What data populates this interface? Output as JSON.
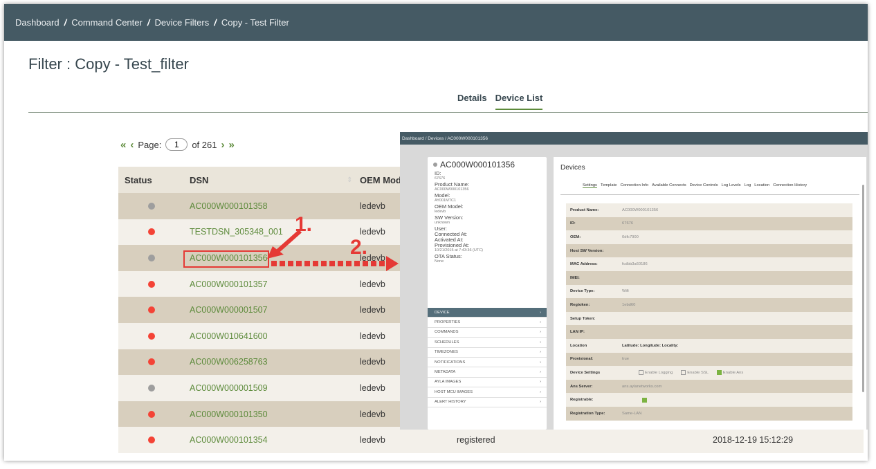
{
  "breadcrumb": [
    "Dashboard",
    "Command Center",
    "Device Filters",
    "Copy - Test Filter"
  ],
  "page_title": "Filter : Copy - Test_filter",
  "tabs": {
    "details": "Details",
    "device_list": "Device List"
  },
  "pager": {
    "label": "Page:",
    "value": "1",
    "of": "of 261"
  },
  "table": {
    "headers": {
      "status": "Status",
      "dsn": "DSN",
      "oem_model": "OEM Mode"
    },
    "rows": [
      {
        "status": "grey",
        "dsn": "AC000W000101358",
        "oem": "ledevb"
      },
      {
        "status": "red",
        "dsn": "TESTDSN_305348_001",
        "oem": "ledevb"
      },
      {
        "status": "grey",
        "dsn": "AC000W000101356",
        "oem": "ledevb"
      },
      {
        "status": "red",
        "dsn": "AC000W000101357",
        "oem": "ledevb"
      },
      {
        "status": "red",
        "dsn": "AC000W000001507",
        "oem": "ledevb"
      },
      {
        "status": "red",
        "dsn": "AC000W010641600",
        "oem": "ledevb"
      },
      {
        "status": "red",
        "dsn": "AC000W006258763",
        "oem": "ledevb"
      },
      {
        "status": "grey",
        "dsn": "AC000W000001509",
        "oem": "ledevb"
      },
      {
        "status": "red",
        "dsn": "AC000W000101350",
        "oem": "ledevb"
      },
      {
        "status": "red",
        "dsn": "AC000W000101354",
        "oem": "ledevb",
        "connection": "registered",
        "timestamp": "2018-12-19 15:12:29"
      }
    ]
  },
  "annotations": {
    "step1": "1.",
    "step2": "2."
  },
  "colors": {
    "red": "#f44336",
    "grey": "#9e9e9e",
    "green": "#5c8a3a",
    "header": "#455a64"
  },
  "inset": {
    "breadcrumb": "Dashboard  /  Devices  /  AC000W000101356",
    "device_title": "AC000W000101356",
    "fields": [
      {
        "label": "ID:",
        "value": "67676"
      },
      {
        "label": "Product Name:",
        "value": "AC000W000101356"
      },
      {
        "label": "Model:",
        "value": "AY001MTC1"
      },
      {
        "label": "OEM Model:",
        "value": "ledevb"
      },
      {
        "label": "SW Version:",
        "value": "unknown"
      },
      {
        "label": "User:",
        "value": ""
      },
      {
        "label": "Connected At:",
        "value": ""
      },
      {
        "label": "Activated At:",
        "value": ""
      },
      {
        "label": "Provisioned At:",
        "value": "10/21/2015 at 7:43:36 (UTC)"
      },
      {
        "label": "OTA Status:",
        "value": "None"
      }
    ],
    "menu": [
      "DEVICE",
      "PROPERTIES",
      "COMMANDS",
      "SCHEDULES",
      "TIMEZONES",
      "NOTIFICATIONS",
      "METADATA",
      "AYLA IMAGES",
      "HOST MCU IMAGES",
      "ALERT HISTORY"
    ],
    "panel_title": "Devices",
    "panel_tabs": [
      "Settings",
      "Template",
      "Connection Info",
      "Available Connects",
      "Device Controls",
      "Log Levels",
      "Log",
      "Location",
      "Connection History"
    ],
    "settings": [
      {
        "label": "Product Name:",
        "value": "AC000W000101356"
      },
      {
        "label": "ID:",
        "value": "67676"
      },
      {
        "label": "OEM:",
        "value": "0dfc7900"
      },
      {
        "label": "Host SW Version:",
        "value": ""
      },
      {
        "label": "MAC Address:",
        "value": "fcdbb3a60186"
      },
      {
        "label": "IMEI:",
        "value": ""
      },
      {
        "label": "Device Type:",
        "value": "Wifi"
      },
      {
        "label": "Regtoken:",
        "value": "1ebd60"
      },
      {
        "label": "Setup Token:",
        "value": ""
      },
      {
        "label": "LAN IP:",
        "value": ""
      },
      {
        "label": "Location",
        "value": "Latitude:    Longitude:    Locality:"
      },
      {
        "label": "Provisional:",
        "value": "true"
      },
      {
        "label": "Device Settings",
        "value": ""
      },
      {
        "label": "Ans Server:",
        "value": "ans.aylanetworks.com"
      },
      {
        "label": "Registrable:",
        "value": ""
      },
      {
        "label": "Registration Type:",
        "value": "Same-LAN"
      }
    ],
    "device_settings_options": [
      "Enable Logging",
      "Enable SSL",
      "Enable Ans"
    ]
  }
}
